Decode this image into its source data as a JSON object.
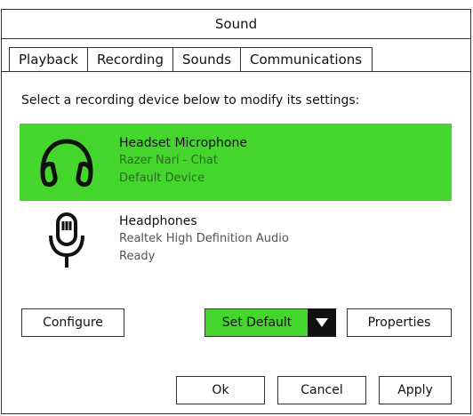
{
  "window": {
    "title": "Sound"
  },
  "tabs": [
    {
      "label": "Playback",
      "active": true
    },
    {
      "label": "Recording",
      "active": false
    },
    {
      "label": "Sounds",
      "active": false
    },
    {
      "label": "Communications",
      "active": false
    }
  ],
  "instruction": "Select a recording device below to modify its settings:",
  "devices": [
    {
      "name": "Headset Microphone",
      "line2": "Razer Nari - Chat",
      "line3": "Default Device",
      "icon": "headset-icon",
      "selected": true
    },
    {
      "name": "Headphones",
      "line2": "Realtek High Definition Audio",
      "line3": "Ready",
      "icon": "microphone-icon",
      "selected": false
    }
  ],
  "buttons": {
    "configure": "Configure",
    "set_default": "Set Default",
    "properties": "Properties",
    "ok": "Ok",
    "cancel": "Cancel",
    "apply": "Apply"
  },
  "colors": {
    "accent": "#44d62c",
    "text": "#111111",
    "border": "#333333"
  }
}
